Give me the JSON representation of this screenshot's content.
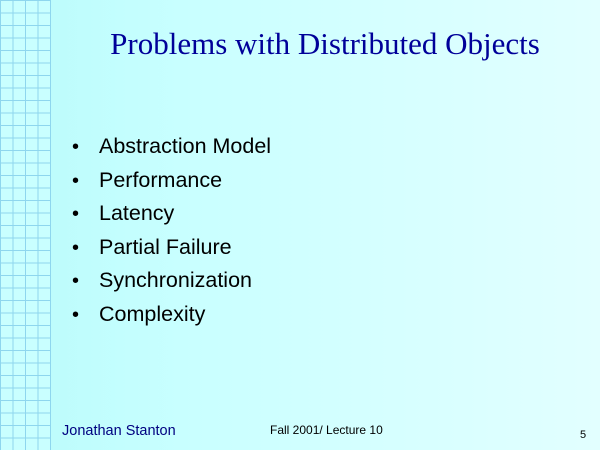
{
  "slide": {
    "title": "Problems with Distributed Objects",
    "bullets": [
      "Abstraction Model",
      "Performance",
      "Latency",
      "Partial Failure",
      "Synchronization",
      "Complexity"
    ],
    "bullet_glyph": "•",
    "footer": {
      "author": "Jonathan Stanton",
      "course": "Fall 2001/ Lecture 10",
      "page_number": "5"
    },
    "colors": {
      "background": "#ccffff",
      "title": "#000099",
      "grid_lines": "#8ed6ee",
      "author_text": "#000080"
    }
  }
}
